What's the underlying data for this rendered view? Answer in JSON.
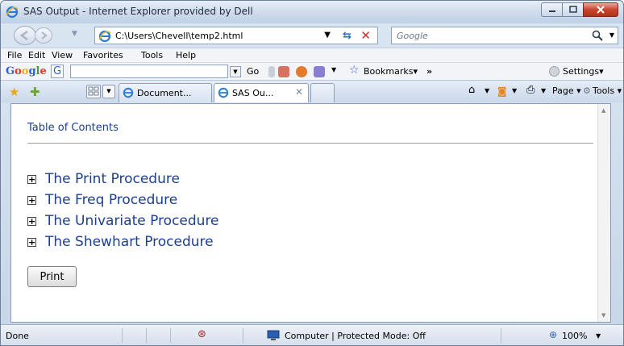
{
  "window": {
    "title": "SAS Output - Internet Explorer provided by Dell"
  },
  "navigation": {
    "address": "C:\\Users\\Chevell\\temp2.html",
    "search_placeholder": "Google"
  },
  "menubar": {
    "items": [
      "File",
      "Edit",
      "View",
      "Favorites",
      "Tools",
      "Help"
    ]
  },
  "google_toolbar": {
    "logo": "Google",
    "go_label": "Go",
    "bookmarks_label": "Bookmarks",
    "overflow": "»",
    "settings_label": "Settings"
  },
  "tabs": {
    "items": [
      {
        "label": "Document...",
        "active": false
      },
      {
        "label": "SAS Ou...",
        "active": true
      }
    ],
    "page_label": "Page",
    "tools_label": "Tools"
  },
  "content": {
    "toc_title": "Table of Contents",
    "procedures": [
      "The Print Procedure",
      "The Freq Procedure",
      "The Univariate Procedure",
      "The Shewhart Procedure"
    ],
    "print_button": "Print"
  },
  "statusbar": {
    "status": "Done",
    "zone": "Computer | Protected Mode: Off",
    "zoom": "100%"
  },
  "colors": {
    "link": "#1c3f95",
    "close_button": "#c9442e"
  }
}
